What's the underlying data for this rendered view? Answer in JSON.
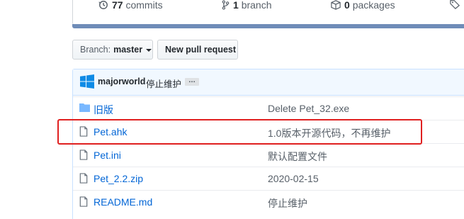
{
  "stats": {
    "commits_count": "77",
    "commits_label": "commits",
    "branch_count": "1",
    "branch_label": "branch",
    "packages_count": "0",
    "packages_label": "packages"
  },
  "toolbar": {
    "branch_prefix": "Branch:",
    "branch_name": "master",
    "new_pull_request": "New pull request"
  },
  "commit": {
    "author": "majorworld",
    "message": "停止维护",
    "ellipsis": "…"
  },
  "files": [
    {
      "type": "folder",
      "name": "旧版",
      "message": "Delete Pet_32.exe"
    },
    {
      "type": "file",
      "name": "Pet.ahk",
      "message": "1.0版本开源代码，不再维护"
    },
    {
      "type": "file",
      "name": "Pet.ini",
      "message": "默认配置文件"
    },
    {
      "type": "file",
      "name": "Pet_2.2.zip",
      "message": "2020-02-15"
    },
    {
      "type": "file",
      "name": "README.md",
      "message": "停止维护"
    }
  ],
  "colors": {
    "link": "#0366d6",
    "highlight": "#e02020",
    "commit_bg": "#f1f8ff"
  }
}
